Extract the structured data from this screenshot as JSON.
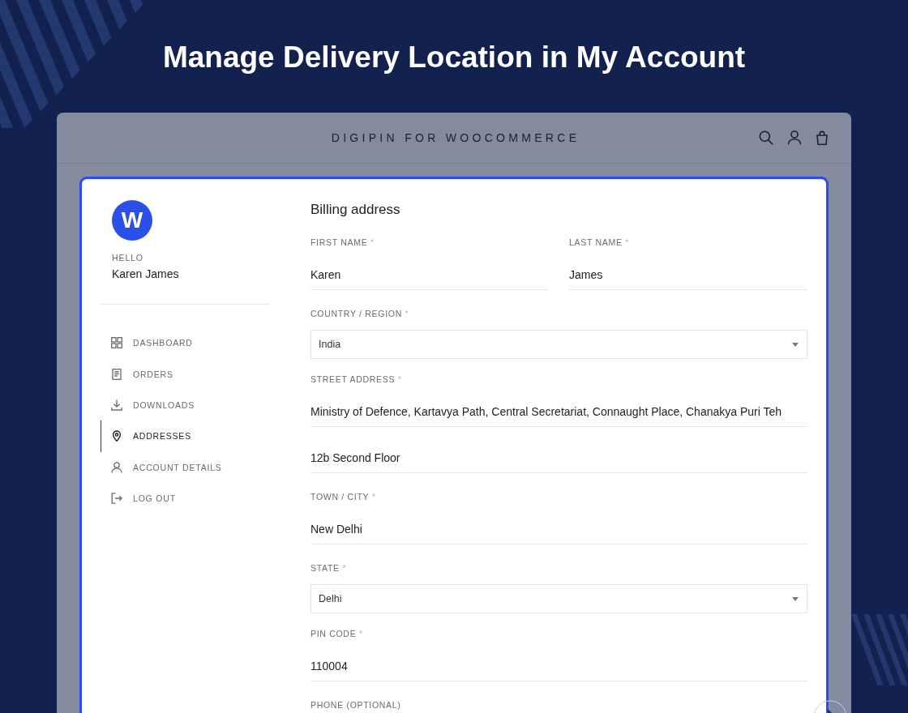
{
  "heading": "Manage Delivery Location in My Account",
  "site": {
    "title": "DIGIPIN FOR WOOCOMMERCE"
  },
  "account": {
    "avatar_letter": "W",
    "greeting": "HELLO",
    "name": "Karen James"
  },
  "nav": [
    {
      "label": "DASHBOARD",
      "selected": false
    },
    {
      "label": "ORDERS",
      "selected": false
    },
    {
      "label": "DOWNLOADS",
      "selected": false
    },
    {
      "label": "ADDRESSES",
      "selected": true
    },
    {
      "label": "ACCOUNT DETAILS",
      "selected": false
    },
    {
      "label": "LOG OUT",
      "selected": false
    }
  ],
  "form": {
    "title": "Billing address",
    "rows": [
      {
        "fields": [
          {
            "kind": "text",
            "label": "FIRST NAME",
            "required_mark": "*",
            "values": [
              "Karen"
            ]
          },
          {
            "kind": "text",
            "label": "LAST NAME",
            "required_mark": "*",
            "values": [
              "James"
            ]
          }
        ]
      },
      {
        "fields": [
          {
            "kind": "select",
            "label": "COUNTRY / REGION",
            "required_mark": "*",
            "value": "India"
          }
        ]
      },
      {
        "fields": [
          {
            "kind": "text",
            "label": "STREET ADDRESS",
            "required_mark": "*",
            "values": [
              "Ministry of Defence, Kartavya Path, Central Secretariat, Connaught Place, Chanakya Puri Teh",
              "12b Second Floor"
            ]
          }
        ]
      },
      {
        "fields": [
          {
            "kind": "text",
            "label": "TOWN / CITY",
            "required_mark": "*",
            "values": [
              "New Delhi"
            ]
          }
        ]
      },
      {
        "fields": [
          {
            "kind": "select",
            "label": "STATE",
            "required_mark": "*",
            "value": "Delhi"
          }
        ]
      },
      {
        "fields": [
          {
            "kind": "text",
            "label": "PIN CODE",
            "required_mark": "*",
            "values": [
              "110004"
            ]
          }
        ]
      },
      {
        "fields": [
          {
            "kind": "text",
            "label": "PHONE (OPTIONAL)"
          }
        ]
      }
    ]
  }
}
